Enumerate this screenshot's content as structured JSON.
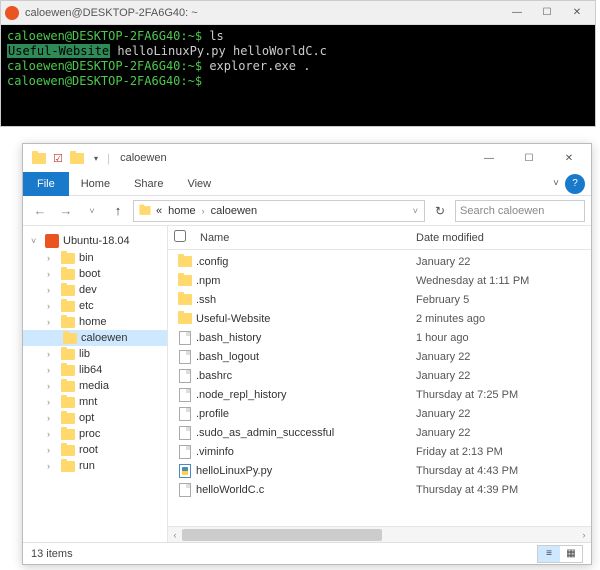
{
  "terminal": {
    "title": "caloewen@DESKTOP-2FA6G40: ~",
    "lines": [
      {
        "prompt": "caloewen@DESKTOP-2FA6G40:~$",
        "cmd": "ls"
      },
      {
        "output": {
          "highlighted": "Useful-Website",
          "rest": "  helloLinuxPy.py  helloWorldC.c"
        }
      },
      {
        "prompt": "caloewen@DESKTOP-2FA6G40:~$",
        "cmd": "explorer.exe ."
      },
      {
        "prompt": "caloewen@DESKTOP-2FA6G40:~$",
        "cmd": ""
      }
    ]
  },
  "explorer": {
    "title": "caloewen",
    "tabs": {
      "file": "File",
      "home": "Home",
      "share": "Share",
      "view": "View"
    },
    "breadcrumb": [
      "«",
      "home",
      "caloewen"
    ],
    "search_placeholder": "Search caloewen",
    "tree": {
      "root": "Ubuntu-18.04",
      "items": [
        "bin",
        "boot",
        "dev",
        "etc",
        "home",
        "lib",
        "lib64",
        "media",
        "mnt",
        "opt",
        "proc",
        "root",
        "run"
      ],
      "selected": "caloewen"
    },
    "columns": {
      "name": "Name",
      "date": "Date modified"
    },
    "files": [
      {
        "name": ".config",
        "type": "folder",
        "date": "January 22"
      },
      {
        "name": ".npm",
        "type": "folder",
        "date": "Wednesday at 1:11 PM"
      },
      {
        "name": ".ssh",
        "type": "folder",
        "date": "February 5"
      },
      {
        "name": "Useful-Website",
        "type": "folder",
        "date": "2 minutes ago"
      },
      {
        "name": ".bash_history",
        "type": "file",
        "date": "1 hour ago"
      },
      {
        "name": ".bash_logout",
        "type": "file",
        "date": "January 22"
      },
      {
        "name": ".bashrc",
        "type": "file",
        "date": "January 22"
      },
      {
        "name": ".node_repl_history",
        "type": "file",
        "date": "Thursday at 7:25 PM"
      },
      {
        "name": ".profile",
        "type": "file",
        "date": "January 22"
      },
      {
        "name": ".sudo_as_admin_successful",
        "type": "file",
        "date": "January 22"
      },
      {
        "name": ".viminfo",
        "type": "file",
        "date": "Friday at 2:13 PM"
      },
      {
        "name": "helloLinuxPy.py",
        "type": "python",
        "date": "Thursday at 4:43 PM"
      },
      {
        "name": "helloWorldC.c",
        "type": "file",
        "date": "Thursday at 4:39 PM"
      }
    ],
    "status": "13 items"
  }
}
